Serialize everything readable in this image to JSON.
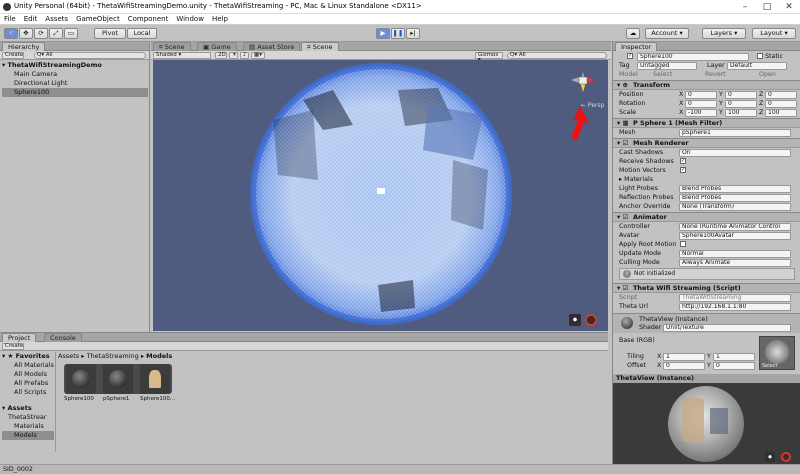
{
  "window": {
    "title": "Unity Personal (64bit) - ThetaWifiStreamingDemo.unity - ThetaWifiStreaming - PC, Mac & Linux Standalone <DX11>"
  },
  "menu": [
    "File",
    "Edit",
    "Assets",
    "GameObject",
    "Component",
    "Window",
    "Help"
  ],
  "toolbar": {
    "pivot": "Pivot",
    "local": "Local",
    "account": "Account",
    "layers": "Layers",
    "layout": "Layout"
  },
  "hierarchy": {
    "tab": "Hierarchy",
    "create": "Create",
    "search_icon": "Q▾ All",
    "scene": "ThetaWifiStreamingDemo",
    "items": [
      "Main Camera",
      "Directional Light",
      "Sphere100"
    ]
  },
  "scene_tabs": [
    "Scene",
    "Game",
    "Asset Store",
    "Scene"
  ],
  "scene_bar": {
    "shading": "Shaded",
    "mode": "2D",
    "gizmos": "Gizmos",
    "search": "Q▾ All"
  },
  "gizmo": {
    "persp": "← Persp"
  },
  "inspector": {
    "tab": "Inspector",
    "object_name": "Sphere100",
    "static": "Static",
    "tag_label": "Tag",
    "tag": "Untagged",
    "layer_label": "Layer",
    "layer": "Default",
    "prefab": [
      "Model",
      "Select",
      "Revert",
      "Open"
    ],
    "transform": {
      "title": "Transform",
      "rows": [
        {
          "label": "Position",
          "x": "0",
          "y": "0",
          "z": "0"
        },
        {
          "label": "Rotation",
          "x": "0",
          "y": "0",
          "z": "0"
        },
        {
          "label": "Scale",
          "x": "-100",
          "y": "100",
          "z": "100"
        }
      ]
    },
    "mesh_filter": {
      "title": "P Sphere 1 (Mesh Filter)",
      "label": "Mesh",
      "value": "pSphere1"
    },
    "mesh_renderer": {
      "title": "Mesh Renderer",
      "cast_label": "Cast Shadows",
      "cast": "On",
      "receive": "Receive Shadows",
      "motion": "Motion Vectors",
      "materials": "Materials",
      "light_label": "Light Probes",
      "light": "Blend Probes",
      "refl_label": "Reflection Probes",
      "refl": "Blend Probes",
      "anchor_label": "Anchor Override",
      "anchor": "None (Transform)"
    },
    "animator": {
      "title": "Animator",
      "controller_label": "Controller",
      "controller": "None (Runtime Animator Control",
      "avatar_label": "Avatar",
      "avatar": "Sphere100Avatar",
      "root": "Apply Root Motion",
      "update_label": "Update Mode",
      "update": "Normal",
      "culling_label": "Culling Mode",
      "culling": "Always Animate",
      "note": "Not initialized"
    },
    "script": {
      "title": "Theta Wifi Streaming (Script)",
      "script_label": "Script",
      "script": "ThetaWifiStreaming",
      "url_label": "Theta Url",
      "url": "http://192.168.1.1:80"
    },
    "material": {
      "name": "ThetaView (Instance)",
      "shader_label": "Shader",
      "shader": "Unlit/Texture",
      "base": "Base (RGB)",
      "tiling": "Tiling",
      "offset": "Offset",
      "tx": "1",
      "ty": "1",
      "ox": "0",
      "oy": "0",
      "select": "Select"
    },
    "preview": "ThetaView (Instance)"
  },
  "project": {
    "tab": "Project",
    "console": "Console",
    "create": "Create",
    "favorites": "Favorites",
    "fav_items": [
      "All Materials",
      "All Models",
      "All Prefabs",
      "All Scripts"
    ],
    "assets": "Assets",
    "tree": [
      "ThetaStrear",
      "Materials",
      "Models"
    ],
    "breadcrumb": [
      "Assets",
      "ThetaStreaming",
      "Models"
    ],
    "items": [
      "Sphere100",
      "pSphere1",
      "Sphere100..."
    ]
  },
  "status": "SID_0002",
  "colors": {
    "scene_bg": "#4f5c80",
    "accent": "#3d6ad6",
    "arrow": "#ee1111"
  }
}
